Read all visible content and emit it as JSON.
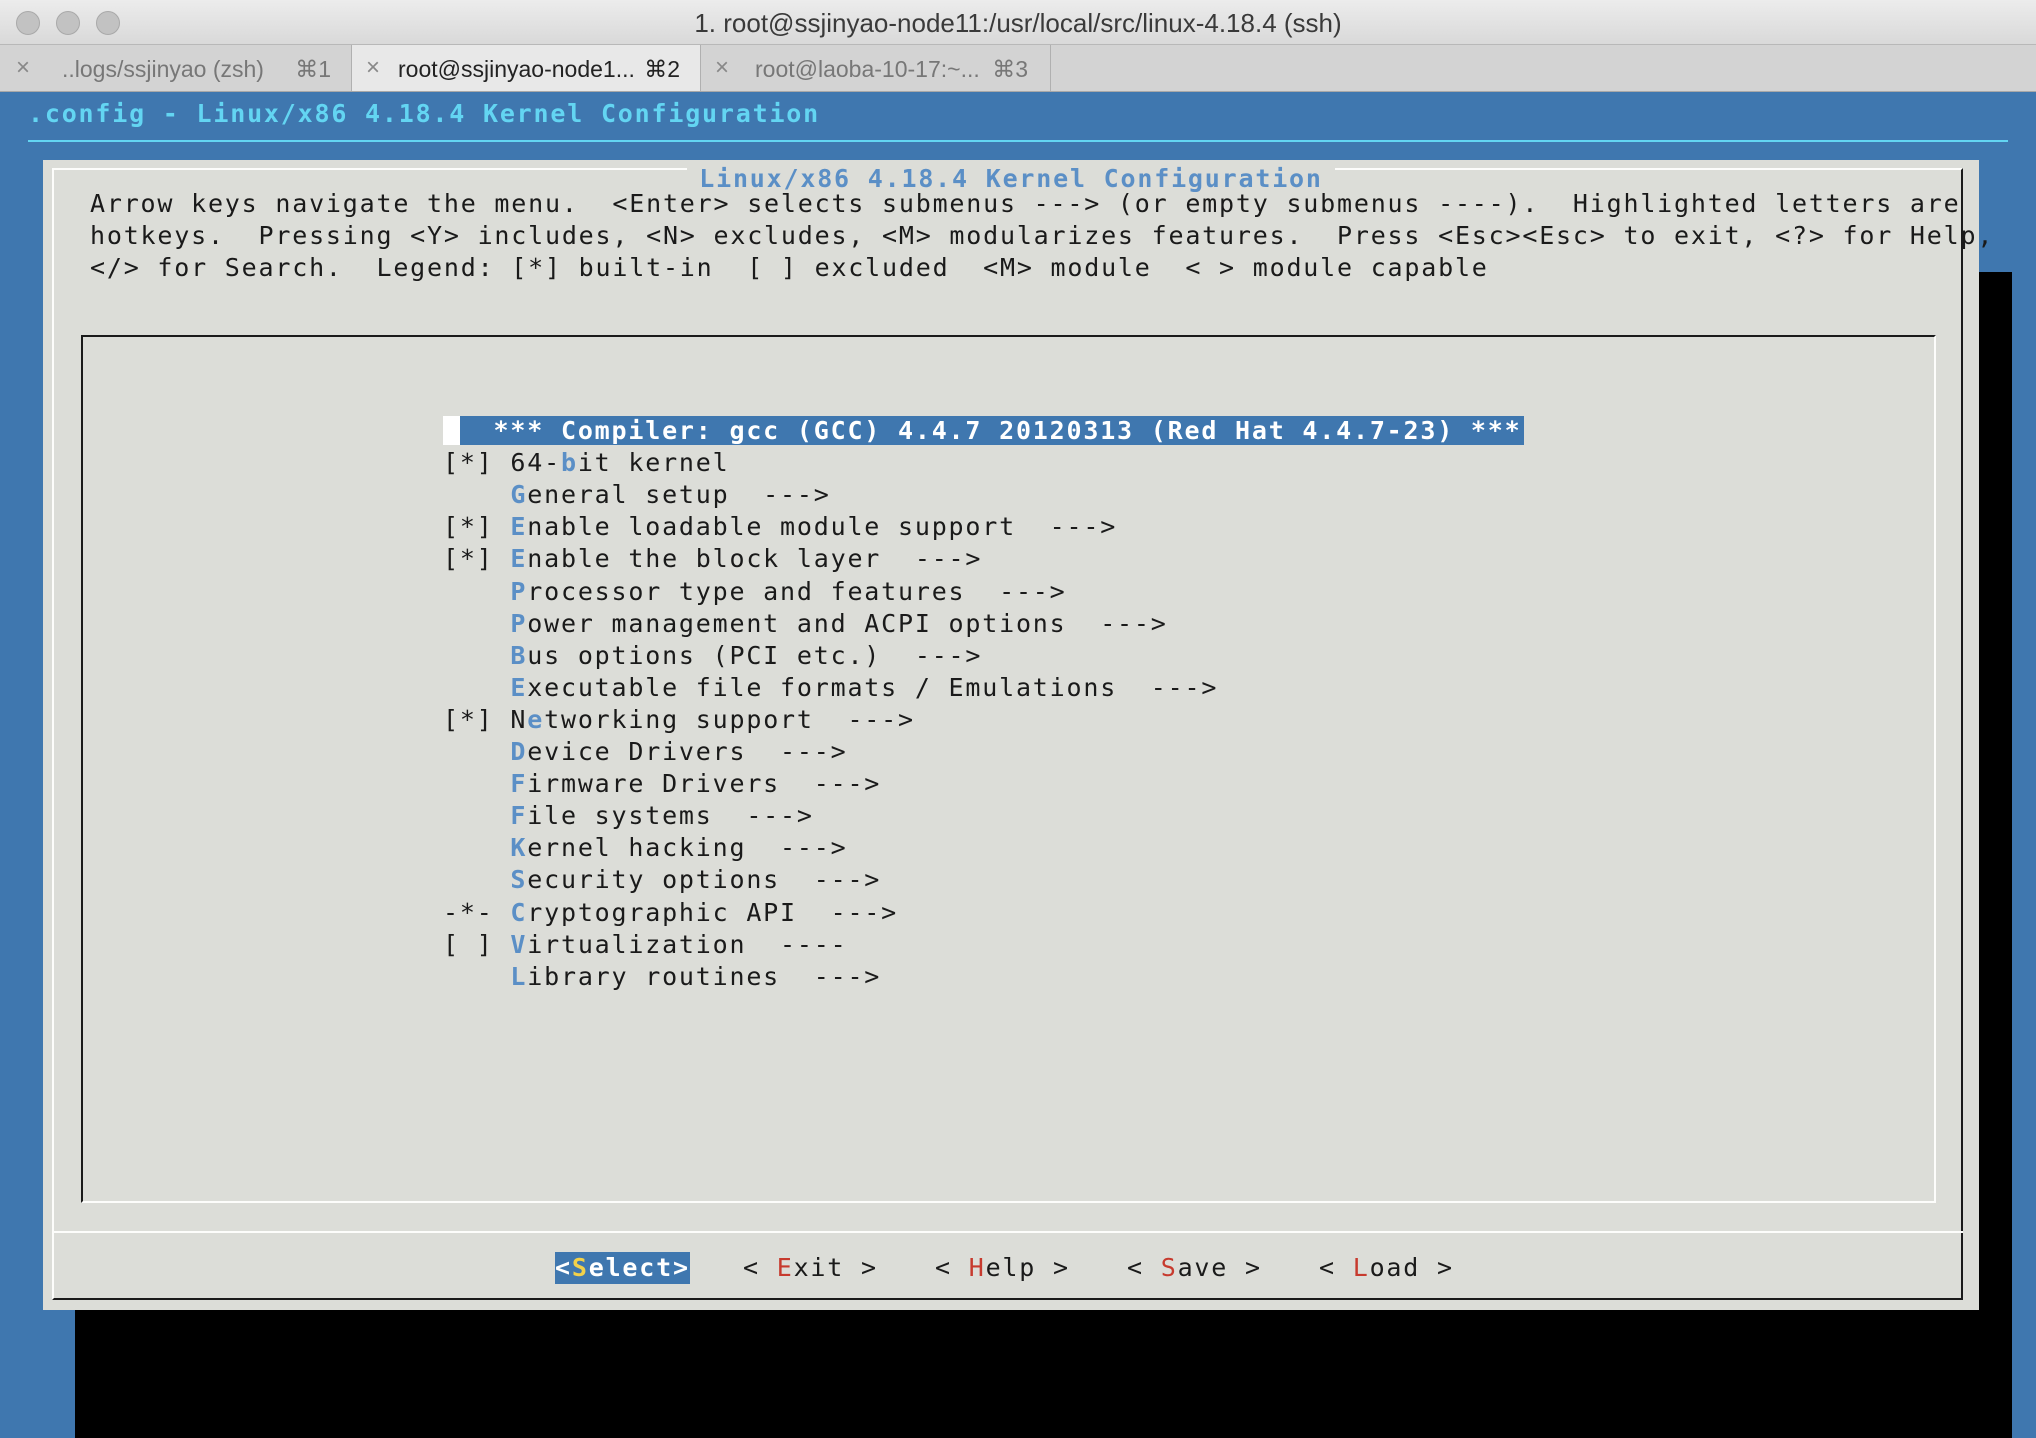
{
  "window": {
    "title": "1. root@ssjinyao-node11:/usr/local/src/linux-4.18.4 (ssh)"
  },
  "tabs": [
    {
      "close": "×",
      "label": "..logs/ssjinyao (zsh)",
      "shortcut": "⌘1"
    },
    {
      "close": "×",
      "label": "root@ssjinyao-node1...",
      "shortcut": "⌘2"
    },
    {
      "close": "×",
      "label": "root@laoba-10-17:~...",
      "shortcut": "⌘3"
    }
  ],
  "terminal": {
    "config_header": ".config - Linux/x86 4.18.4 Kernel Configuration",
    "dialog_title": "Linux/x86 4.18.4 Kernel Configuration",
    "help_lines": [
      "Arrow keys navigate the menu.  <Enter> selects submenus ---> (or empty submenus ----).  Highlighted letters are",
      "hotkeys.  Pressing <Y> includes, <N> excludes, <M> modularizes features.  Press <Esc><Esc> to exit, <?> for Help,",
      "</> for Search.  Legend: [*] built-in  [ ] excluded  <M> module  < > module capable"
    ],
    "menu": [
      {
        "prefix": " ",
        "hotkey": "",
        "pre": "",
        "rest": "  *** Compiler: gcc (GCC) 4.4.7 20120313 (Red Hat 4.4.7-23) ***",
        "selected": true
      },
      {
        "prefix": "[*] ",
        "pre": "64-",
        "hotkey": "b",
        "rest": "it kernel"
      },
      {
        "prefix": "    ",
        "pre": "",
        "hotkey": "G",
        "rest": "eneral setup  --->"
      },
      {
        "prefix": "[*] ",
        "pre": "",
        "hotkey": "E",
        "rest": "nable loadable module support  --->"
      },
      {
        "prefix": "[*] ",
        "pre": "",
        "hotkey": "E",
        "rest": "nable the block layer  --->"
      },
      {
        "prefix": "    ",
        "pre": "",
        "hotkey": "P",
        "rest": "rocessor type and features  --->"
      },
      {
        "prefix": "    ",
        "pre": "",
        "hotkey": "P",
        "rest": "ower management and ACPI options  --->"
      },
      {
        "prefix": "    ",
        "pre": "",
        "hotkey": "B",
        "rest": "us options (PCI etc.)  --->"
      },
      {
        "prefix": "    ",
        "pre": "",
        "hotkey": "E",
        "rest": "xecutable file formats / Emulations  --->"
      },
      {
        "prefix": "[*] ",
        "pre": "N",
        "hotkey": "e",
        "rest": "tworking support  --->"
      },
      {
        "prefix": "    ",
        "pre": "",
        "hotkey": "D",
        "rest": "evice Drivers  --->"
      },
      {
        "prefix": "    ",
        "pre": "",
        "hotkey": "F",
        "rest": "irmware Drivers  --->"
      },
      {
        "prefix": "    ",
        "pre": "",
        "hotkey": "F",
        "rest": "ile systems  --->"
      },
      {
        "prefix": "    ",
        "pre": "",
        "hotkey": "K",
        "rest": "ernel hacking  --->"
      },
      {
        "prefix": "    ",
        "pre": "",
        "hotkey": "S",
        "rest": "ecurity options  --->"
      },
      {
        "prefix": "-*- ",
        "pre": "",
        "hotkey": "C",
        "rest": "ryptographic API  --->"
      },
      {
        "prefix": "[ ] ",
        "pre": "",
        "hotkey": "V",
        "rest": "irtualization  ----"
      },
      {
        "prefix": "    ",
        "pre": "",
        "hotkey": "L",
        "rest": "ibrary routines  --->"
      }
    ],
    "buttons": [
      {
        "pre": "<",
        "key": "S",
        "rest": "elect>",
        "active": true
      },
      {
        "pre": "< ",
        "key": "E",
        "rest": "xit >",
        "active": false
      },
      {
        "pre": "< ",
        "key": "H",
        "rest": "elp >",
        "active": false
      },
      {
        "pre": "< ",
        "key": "S",
        "rest": "ave >",
        "active": false
      },
      {
        "pre": "< ",
        "key": "L",
        "rest": "oad >",
        "active": false
      }
    ]
  },
  "colors": {
    "terminal_bg": "#3f77af",
    "dialog_bg": "#dcddd8",
    "hotkey": "#5b8fc6",
    "header_text": "#63d5f2",
    "button_key": "#c73a2e"
  }
}
